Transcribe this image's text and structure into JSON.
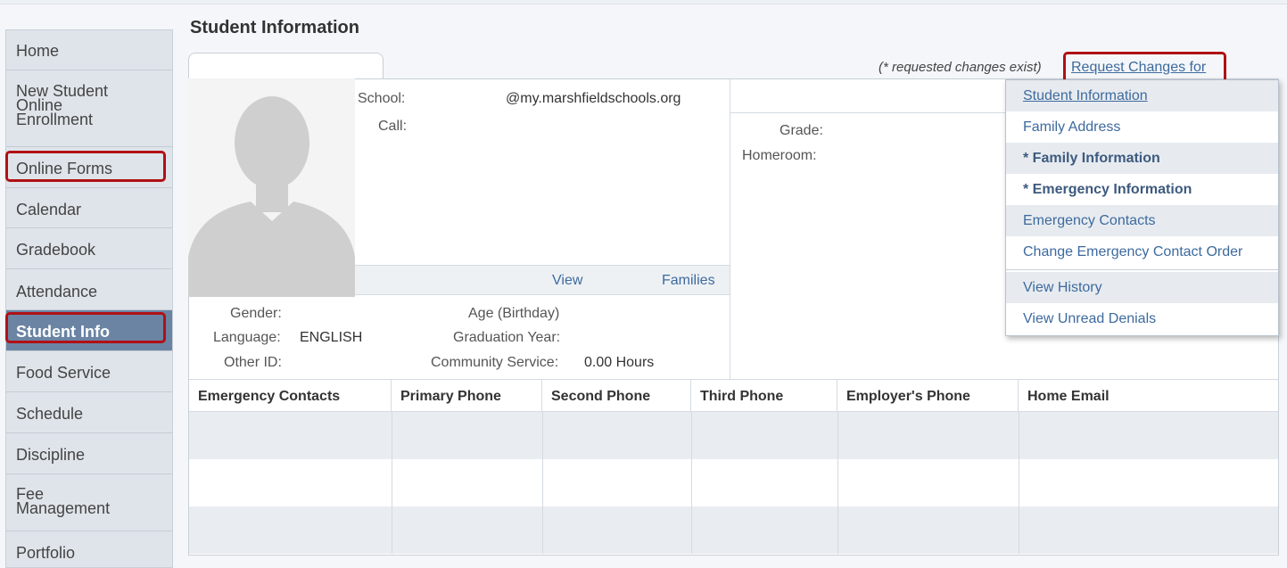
{
  "page": {
    "title": "Student Information"
  },
  "sidebar": {
    "items": [
      {
        "label": "Home"
      },
      {
        "label": "New Student Online Enrollment",
        "lines": [
          "New Student",
          "Online",
          "Enrollment"
        ]
      },
      {
        "label": "Online Forms"
      },
      {
        "label": "Calendar"
      },
      {
        "label": "Gradebook"
      },
      {
        "label": "Attendance"
      },
      {
        "label": "Student Info"
      },
      {
        "label": "Food Service"
      },
      {
        "label": "Schedule"
      },
      {
        "label": "Discipline"
      },
      {
        "label": "Fee Management",
        "lines": [
          "Fee",
          "Management"
        ]
      },
      {
        "label": "Portfolio"
      }
    ],
    "active": "Student Info"
  },
  "student": {
    "school_label": "School:",
    "email": "@my.marshfieldschools.org",
    "call_label": "Call:",
    "grade_label": "Grade:",
    "homeroom_label": "Homeroom:",
    "view_link": "View",
    "families_link": "Families",
    "gender_label": "Gender:",
    "language_label": "Language:",
    "language_value": "ENGLISH",
    "other_id_label": "Other ID:",
    "age_label": "Age (Birthday)",
    "graduation_label": "Graduation Year:",
    "community_label": "Community Service:",
    "community_value": "0.00 Hours"
  },
  "request": {
    "note": "(* requested changes exist)",
    "link_label": "Request Changes for",
    "menu": [
      {
        "label": "Student Information"
      },
      {
        "label": "Family Address"
      },
      {
        "label": "* Family Information"
      },
      {
        "label": "* Emergency Information"
      },
      {
        "label": "Emergency Contacts"
      },
      {
        "label": "Change Emergency Contact Order"
      },
      {
        "label": "View History"
      },
      {
        "label": "View Unread Denials"
      }
    ]
  },
  "contacts_table": {
    "columns": [
      "Emergency Contacts",
      "Primary Phone",
      "Second Phone",
      "Third Phone",
      "Employer's Phone",
      "Home Email"
    ]
  },
  "colors": {
    "accent_link": "#3d6a9e",
    "active_nav": "#6b84a4",
    "highlight_box": "#b01016"
  },
  "icons": [
    "person-silhouette-icon"
  ]
}
